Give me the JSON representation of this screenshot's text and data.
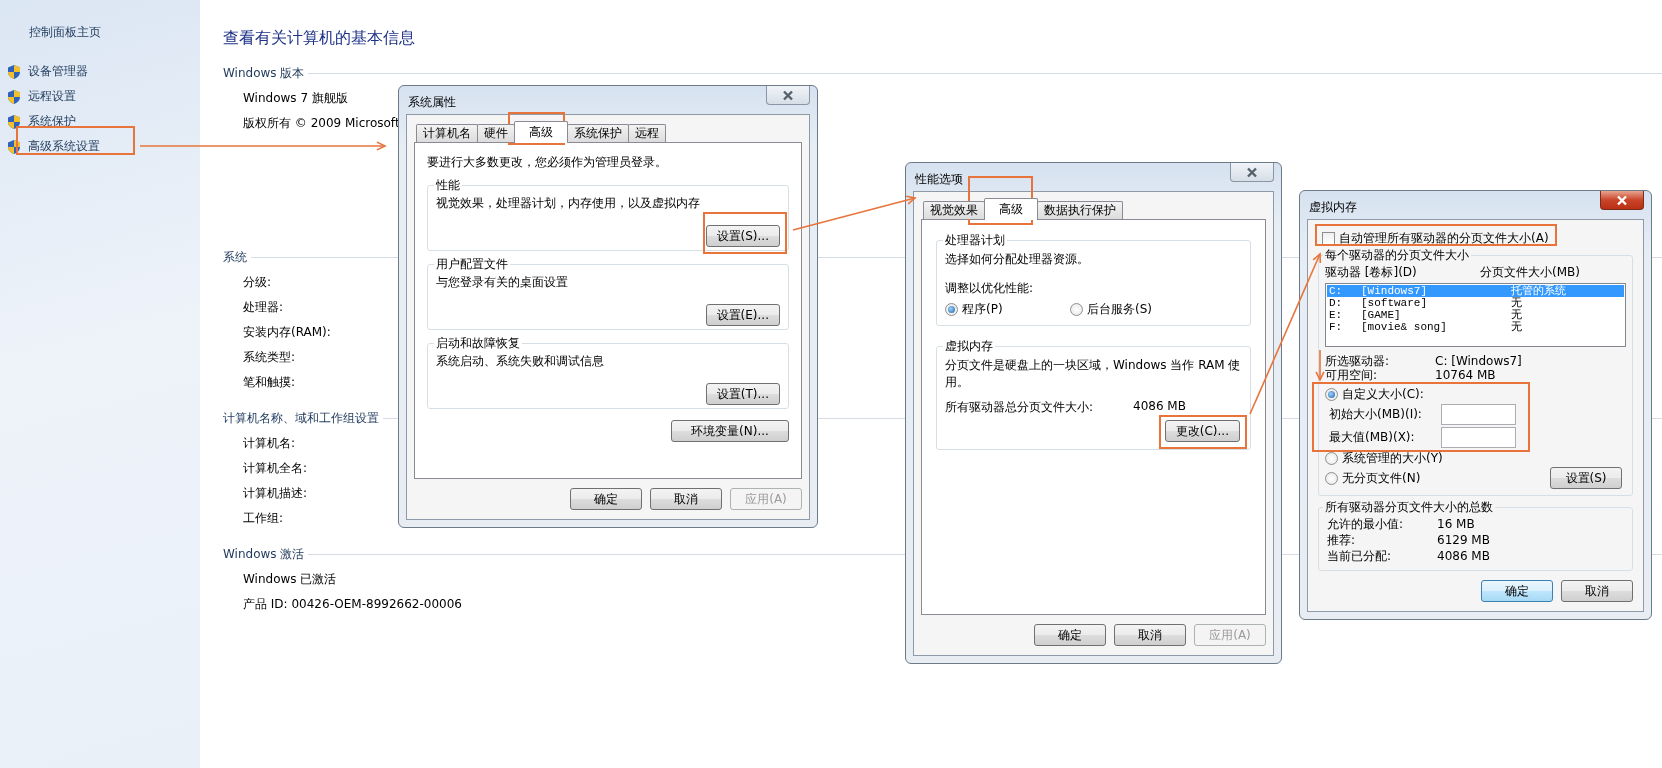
{
  "sidebar": {
    "home": "控制面板主页",
    "items": [
      {
        "label": "设备管理器"
      },
      {
        "label": "远程设置"
      },
      {
        "label": "系统保护"
      },
      {
        "label": "高级系统设置"
      }
    ]
  },
  "main": {
    "title": "查看有关计算机的基本信息",
    "sections": [
      {
        "heading": "Windows 版本",
        "rows": [
          "Windows 7 旗舰版",
          "版权所有 © 2009 Microsoft"
        ]
      },
      {
        "heading": "系统",
        "rows": [
          "分级:",
          "处理器:",
          "安装内存(RAM):",
          "系统类型:",
          "笔和触摸:"
        ]
      },
      {
        "heading": "计算机名称、域和工作组设置",
        "rows": [
          "计算机名:",
          "计算机全名:",
          "计算机描述:",
          "工作组:"
        ]
      },
      {
        "heading": "Windows 激活",
        "rows": [
          "Windows 已激活",
          "产品 ID: 00426-OEM-8992662-00006"
        ]
      }
    ]
  },
  "system_properties": {
    "title": "系统属性",
    "tabs": [
      {
        "label": "计算机名",
        "selected": false
      },
      {
        "label": "硬件",
        "selected": false
      },
      {
        "label": "高级",
        "selected": true
      },
      {
        "label": "系统保护",
        "selected": false
      },
      {
        "label": "远程",
        "selected": false
      }
    ],
    "notice": "要进行大多数更改，您必须作为管理员登录。",
    "groups": [
      {
        "title": "性能",
        "description": "视觉效果，处理器计划，内存使用，以及虚拟内存",
        "button": "设置(S)..."
      },
      {
        "title": "用户配置文件",
        "description": "与您登录有关的桌面设置",
        "button": "设置(E)..."
      },
      {
        "title": "启动和故障恢复",
        "description": "系统启动、系统失败和调试信息",
        "button": "设置(T)..."
      }
    ],
    "env_button": "环境变量(N)...",
    "buttons": [
      {
        "label": "确定",
        "disabled": false
      },
      {
        "label": "取消",
        "disabled": false
      },
      {
        "label": "应用(A)",
        "disabled": true
      }
    ]
  },
  "performance_options": {
    "title": "性能选项",
    "tabs": [
      {
        "label": "视觉效果",
        "selected": false
      },
      {
        "label": "高级",
        "selected": true
      },
      {
        "label": "数据执行保护",
        "selected": false
      }
    ],
    "processor_group": {
      "title": "处理器计划",
      "description": "选择如何分配处理器资源。",
      "prompt": "调整以优化性能:",
      "options": [
        {
          "label": "程序(P)",
          "selected": true
        },
        {
          "label": "后台服务(S)",
          "selected": false
        }
      ]
    },
    "vm_group": {
      "title": "虚拟内存",
      "description": "分页文件是硬盘上的一块区域，Windows 当作 RAM 使用。",
      "total_label": "所有驱动器总分页文件大小:",
      "total_value": "4086 MB",
      "button": "更改(C)..."
    },
    "buttons": [
      {
        "label": "确定",
        "disabled": false
      },
      {
        "label": "取消",
        "disabled": false
      },
      {
        "label": "应用(A)",
        "disabled": true
      }
    ]
  },
  "virtual_memory": {
    "title": "虚拟内存",
    "auto_manage": {
      "label": "自动管理所有驱动器的分页文件大小(A)",
      "checked": false
    },
    "drives_group": {
      "title": "每个驱动器的分页文件大小",
      "drive_header": "驱动器 [卷标](D)",
      "size_header": "分页文件大小(MB)"
    },
    "drives": [
      {
        "letter": "C:",
        "volume": "[Windows7]",
        "size": "托管的系统",
        "selected": true
      },
      {
        "letter": "D:",
        "volume": "[software]",
        "size": "无",
        "selected": false
      },
      {
        "letter": "E:",
        "volume": "[GAME]",
        "size": "无",
        "selected": false
      },
      {
        "letter": "F:",
        "volume": "[movie& song]",
        "size": "无",
        "selected": false
      }
    ],
    "selected_drive_label": "所选驱动器:",
    "selected_drive_value": "C:  [Windows7]",
    "free_label": "可用空间:",
    "free_value": "10764 MB",
    "size_options": [
      {
        "label": "自定义大小(C):",
        "selected": true
      },
      {
        "label": "系统管理的大小(Y)",
        "selected": false
      },
      {
        "label": "无分页文件(N)",
        "selected": false
      }
    ],
    "initial_label": "初始大小(MB)(I):",
    "max_label": "最大值(MB)(X):",
    "set_button": "设置(S)",
    "totals": {
      "title": "所有驱动器分页文件大小的总数",
      "rows": [
        {
          "label": "允许的最小值:",
          "value": "16 MB"
        },
        {
          "label": "推荐:",
          "value": "6129 MB"
        },
        {
          "label": "当前已分配:",
          "value": "4086 MB"
        }
      ]
    },
    "buttons": [
      {
        "label": "确定",
        "default": true
      },
      {
        "label": "取消",
        "default": false
      }
    ]
  }
}
